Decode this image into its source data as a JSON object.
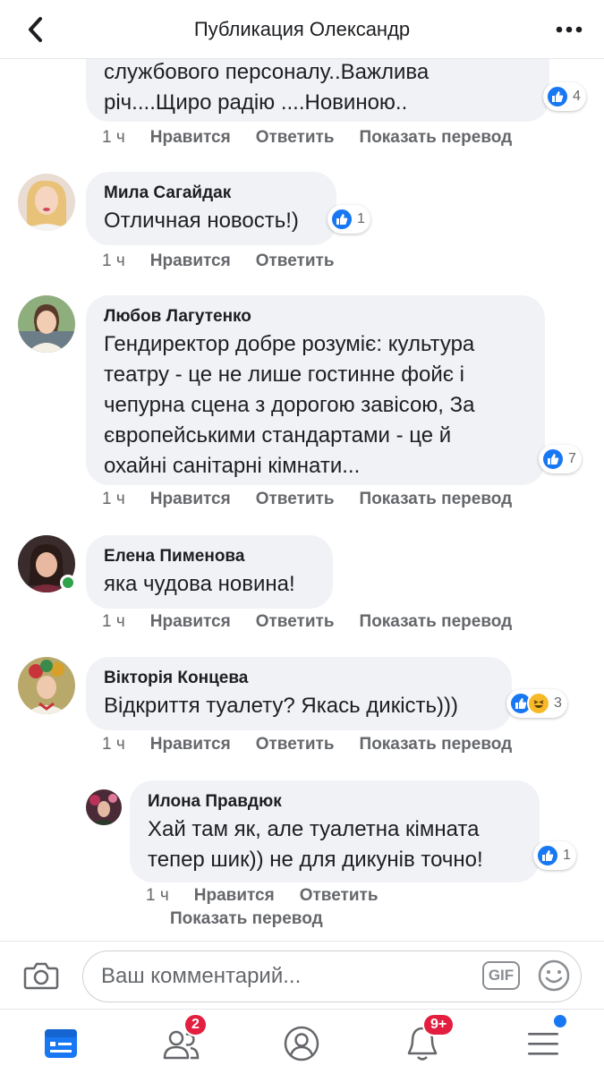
{
  "header": {
    "title": "Публикация Олександр"
  },
  "actions": {
    "time": "1 ч",
    "like": "Нравится",
    "reply": "Ответить",
    "translate": "Показать перевод"
  },
  "comments": [
    {
      "author": "",
      "text": "службового персоналу..Важлива\nріч....Щиро радію ....Новиною..",
      "reactions": "4"
    },
    {
      "author": "Мила Сагайдак",
      "text": "Отличная новость!)",
      "reactions": "1"
    },
    {
      "author": "Любов Лагутенко",
      "text": "Гендиректор добре розуміє:  культура\nтеатру - це не лише гостинне фойє і\nчепурна сцена з дорогою завісою, За\nєвропейськими стандартами - це й\nохайні санітарні кімнати...",
      "reactions": "7"
    },
    {
      "author": "Елена Пименова",
      "text": "яка чудова новина!",
      "reactions": ""
    },
    {
      "author": "Вікторія Концева",
      "text": "Відкриття туалету? Якась дикість)))",
      "reactions": "3"
    },
    {
      "author": "Илона Правдюк",
      "text": "Хай там як, але туалетна кімната\nтепер шик)) не для дикунів точно!",
      "reactions": "1"
    }
  ],
  "composer": {
    "placeholder": "Ваш комментарий...",
    "gif_label": "GIF"
  },
  "tabbar": {
    "friends_badge": "2",
    "notifications_badge": "9+"
  },
  "icons": {
    "back": "chevron-left-icon",
    "more": "more-horizontal-icon",
    "like_reaction": "like-reaction-icon",
    "haha_reaction": "haha-reaction-icon",
    "camera": "camera-icon",
    "emoji": "emoji-icon",
    "news_feed": "news-feed-icon",
    "friends": "friends-icon",
    "profile": "profile-icon",
    "notifications": "bell-icon",
    "menu": "menu-icon"
  },
  "colors": {
    "accent": "#1877f2",
    "badge": "#e41e3f",
    "bubble": "#f0f2f5",
    "online": "#31a24c",
    "meta_text": "#65676b"
  }
}
